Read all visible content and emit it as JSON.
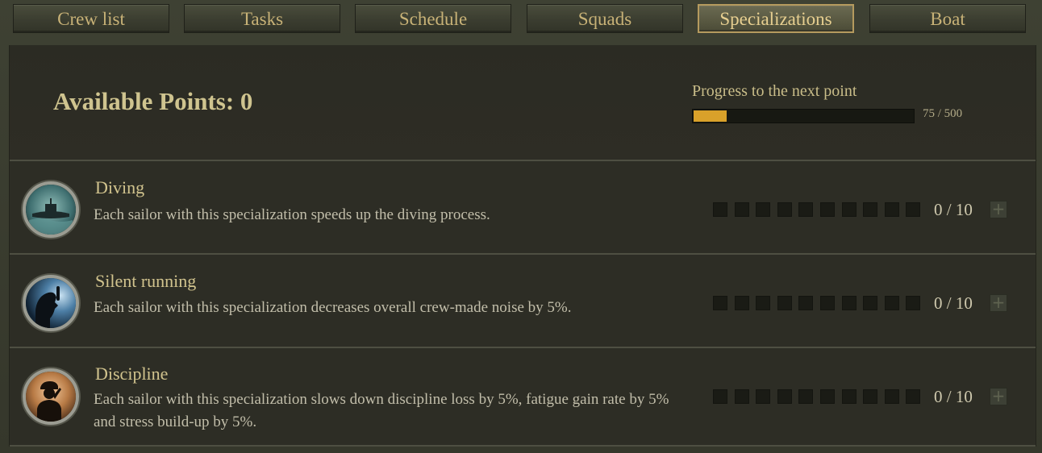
{
  "tabs": [
    {
      "label": "Crew list",
      "active": false
    },
    {
      "label": "Tasks",
      "active": false
    },
    {
      "label": "Schedule",
      "active": false
    },
    {
      "label": "Squads",
      "active": false
    },
    {
      "label": "Specializations",
      "active": true
    },
    {
      "label": "Boat",
      "active": false
    }
  ],
  "points": {
    "available_label": "Available Points: 0",
    "progress_label": "Progress to the next point",
    "progress_text": "75 / 500",
    "progress_current": 75,
    "progress_max": 500,
    "progress_color": "#d9a12a"
  },
  "specializations": [
    {
      "name": "Diving",
      "icon": "diving-submarine-icon",
      "description": "Each sailor with this specialization speeds up the diving process.",
      "count_text": "0 / 10",
      "level": 0,
      "max_level": 10
    },
    {
      "name": "Silent running",
      "icon": "silent-running-icon",
      "description": "Each sailor with this specialization decreases overall crew-made noise by 5%.",
      "count_text": "0 / 10",
      "level": 0,
      "max_level": 10
    },
    {
      "name": "Discipline",
      "icon": "discipline-salute-icon",
      "description": "Each sailor with this specialization slows down discipline loss by 5%, fatigue gain rate by 5% and stress build-up by 5%.",
      "count_text": "0 / 10",
      "level": 0,
      "max_level": 10
    }
  ],
  "plus_glyph": "+",
  "colors": {
    "accent_text": "#c8b277",
    "active_tab_border": "#b59a5e",
    "panel_background": "#2c2c24"
  }
}
